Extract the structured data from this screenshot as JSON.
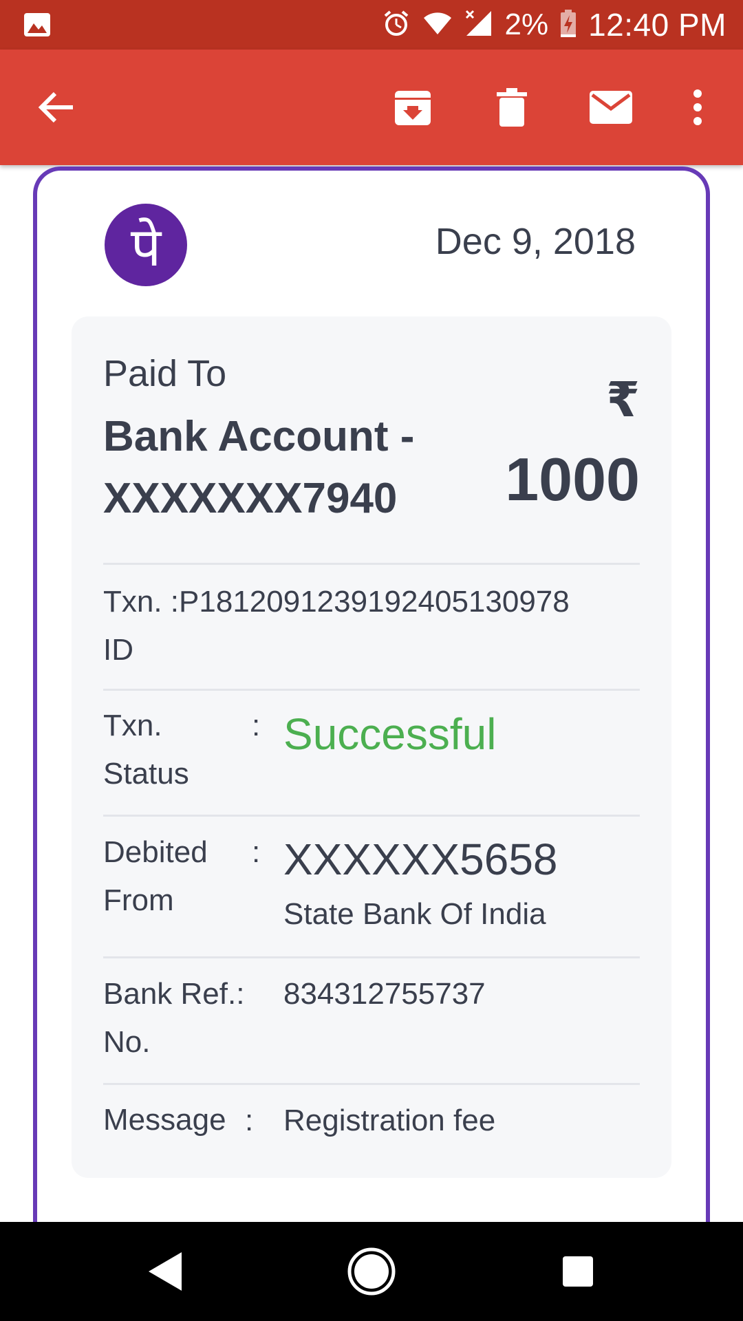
{
  "status_bar": {
    "battery": "2%",
    "time": "12:40 PM",
    "icons": [
      "image-icon",
      "alarm-icon",
      "wifi-icon",
      "signal-icon",
      "battery-charging-icon"
    ]
  },
  "app_bar": {
    "icons": [
      "back-arrow-icon",
      "archive-icon",
      "delete-icon",
      "mail-icon",
      "more-vert-icon"
    ]
  },
  "email": {
    "logo_glyph": "पे",
    "date": "Dec 9, 2018",
    "paid_to_label": "Paid To",
    "account_line1": "Bank Account -",
    "account_line2": "XXXXXXX7940",
    "currency": "₹",
    "amount": "1000",
    "txn_id_label_1": "Txn. :",
    "txn_id_value": "P1812091239192405130978",
    "txn_id_label_2": "ID",
    "txn_status_label_1": "Txn.",
    "txn_status_label_2": "Status",
    "colon": ":",
    "txn_status_value": "Successful",
    "debited_label_1": "Debited",
    "debited_label_2": "From",
    "debited_account": "XXXXXX5658",
    "debited_bank": "State Bank Of India",
    "bank_ref_label_1": "Bank Ref.",
    "bank_ref_label_2": "No.",
    "bank_ref_colon": ":",
    "bank_ref_value": "834312755737",
    "message_label": "Message",
    "message_colon": ":",
    "message_value": "Registration fee"
  },
  "colors": {
    "status_bar": "#b93221",
    "app_bar": "#db4437",
    "card_border": "#673ab7",
    "logo_bg": "#5f259f",
    "success": "#4caf50"
  }
}
